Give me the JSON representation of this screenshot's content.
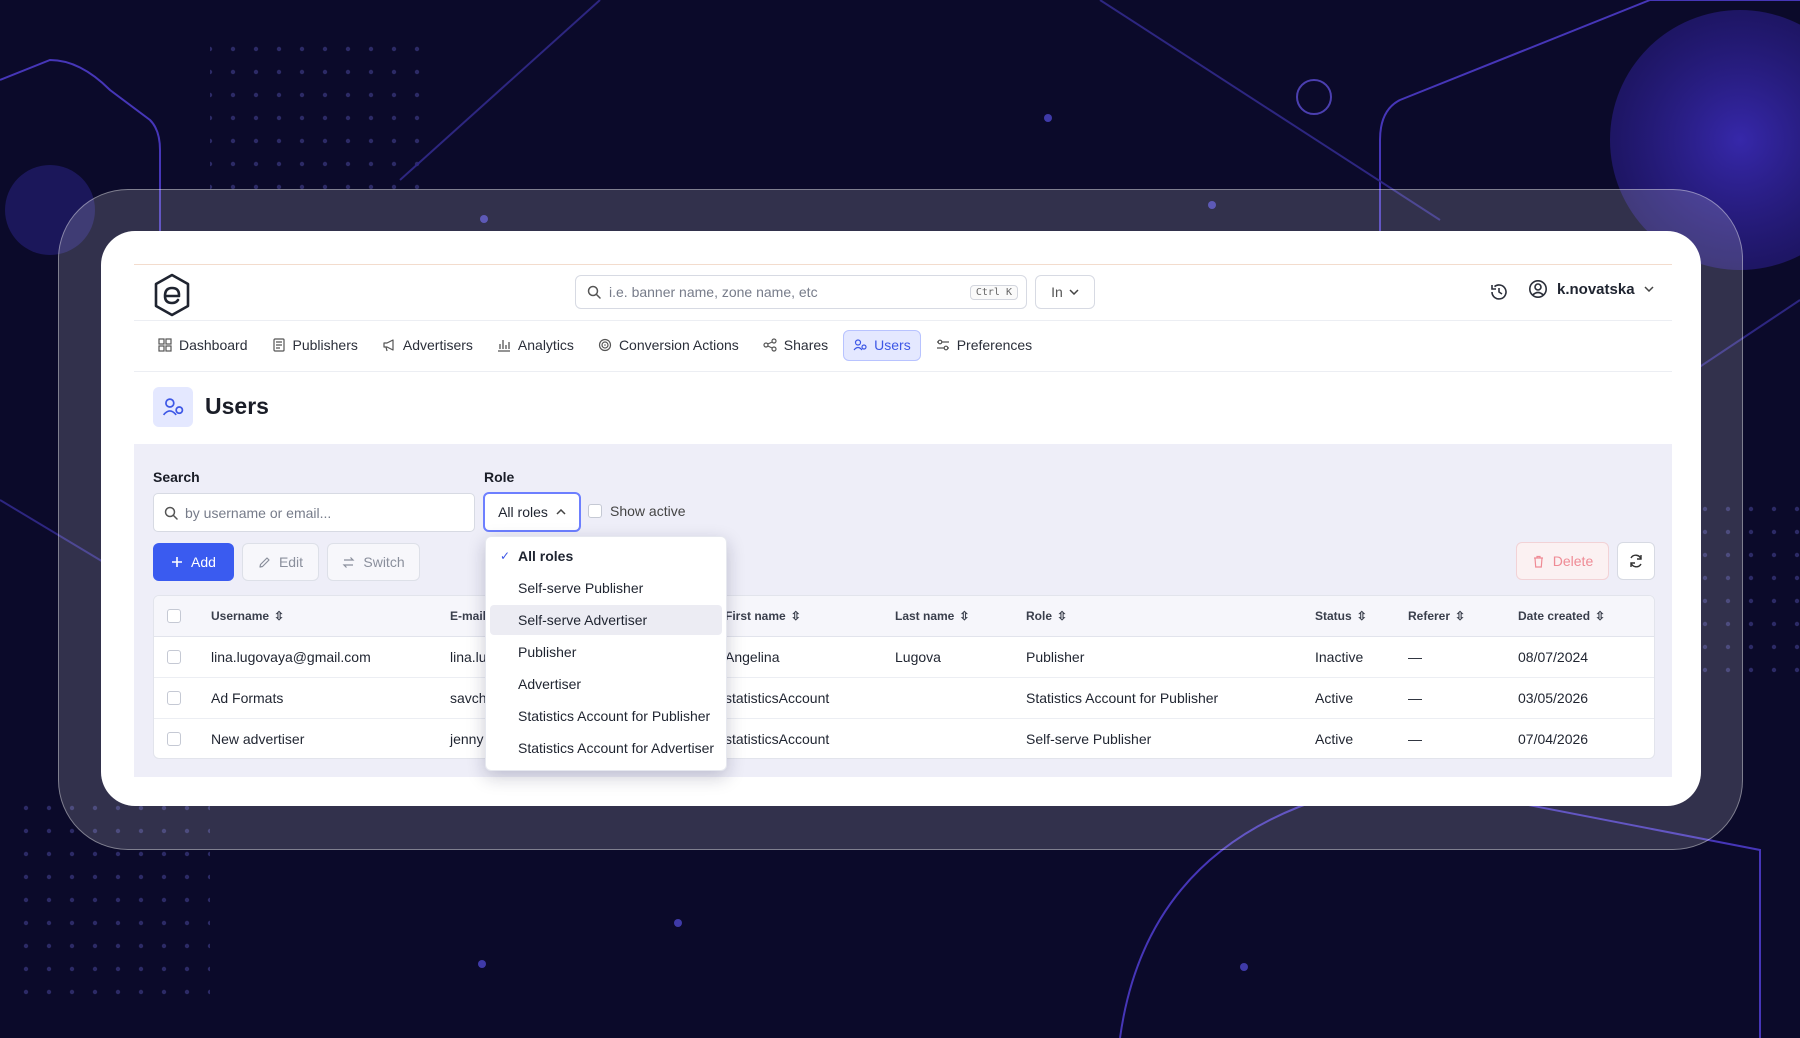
{
  "colors": {
    "accent": "#3a5bf0",
    "active_nav_bg": "#e4e8ff",
    "delete_text": "#ef8b95",
    "background": "#0b0a2a"
  },
  "header": {
    "search_placeholder": "i.e. banner name, zone name, etc",
    "shortcut": "Ctrl K",
    "scope": "In",
    "username": "k.novatska"
  },
  "nav": {
    "items": [
      {
        "label": "Dashboard",
        "icon": "dashboard-icon"
      },
      {
        "label": "Publishers",
        "icon": "publishers-icon"
      },
      {
        "label": "Advertisers",
        "icon": "megaphone-icon"
      },
      {
        "label": "Analytics",
        "icon": "bar-chart-icon"
      },
      {
        "label": "Conversion Actions",
        "icon": "target-icon"
      },
      {
        "label": "Shares",
        "icon": "share-icon"
      },
      {
        "label": "Users",
        "icon": "users-icon",
        "active": true
      },
      {
        "label": "Preferences",
        "icon": "sliders-icon"
      }
    ]
  },
  "page": {
    "title": "Users"
  },
  "filters": {
    "search_label": "Search",
    "search_placeholder": "by username or email...",
    "role_label": "Role",
    "role_value": "All roles",
    "show_active": "Show active"
  },
  "toolbar": {
    "add": "Add",
    "edit": "Edit",
    "switch": "Switch",
    "delete": "Delete"
  },
  "table": {
    "columns": [
      "Username",
      "E-mail",
      "First name",
      "Last name",
      "Role",
      "Status",
      "Referer",
      "Date created"
    ],
    "rows": [
      {
        "username": "lina.lugovaya@gmail.com",
        "email": "lina.lu",
        "first": "Angelina",
        "last": "Lugova",
        "role": "Publisher",
        "status": "Inactive",
        "referer": "—",
        "date": "08/07/2024"
      },
      {
        "username": "Ad Formats",
        "email": "savch",
        "first": "statisticsAccount",
        "last": "",
        "role": "Statistics Account for Publisher",
        "status": "Active",
        "referer": "—",
        "date": "03/05/2026"
      },
      {
        "username": "New advertiser",
        "email": "jenny",
        "first": "statisticsAccount",
        "last": "",
        "role": "Self-serve Publisher",
        "status": "Active",
        "referer": "—",
        "date": "07/04/2026"
      }
    ]
  },
  "role_dropdown": {
    "options": [
      {
        "label": "All roles",
        "selected": true
      },
      {
        "label": "Self-serve Publisher"
      },
      {
        "label": "Self-serve Advertiser",
        "highlighted": true
      },
      {
        "label": "Publisher"
      },
      {
        "label": "Advertiser"
      },
      {
        "label": "Statistics Account for Publisher"
      },
      {
        "label": "Statistics Account for Advertiser"
      }
    ]
  }
}
